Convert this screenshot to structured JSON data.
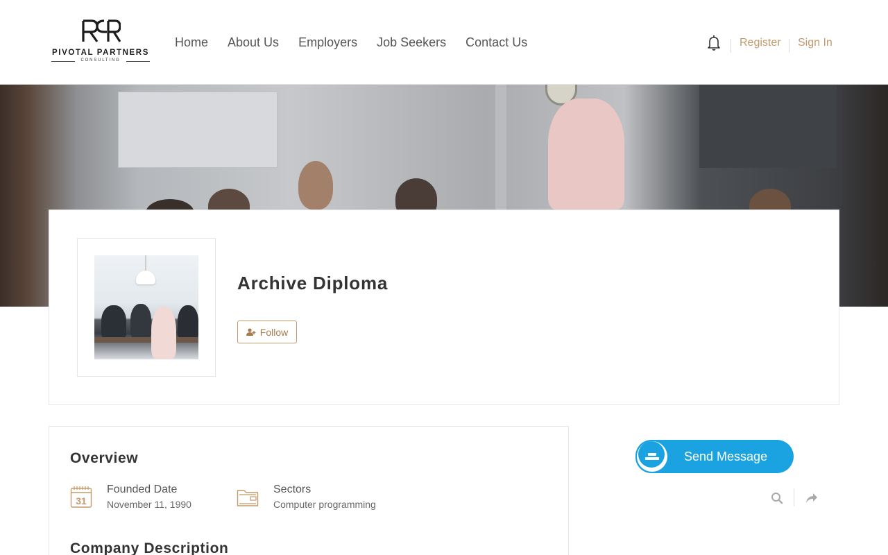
{
  "brand": {
    "name": "PIVOTAL PARTNERS",
    "tagline": "CONSULTING"
  },
  "nav": {
    "items": [
      {
        "label": "Home"
      },
      {
        "label": "About Us"
      },
      {
        "label": "Employers"
      },
      {
        "label": "Job Seekers"
      },
      {
        "label": "Contact Us"
      }
    ]
  },
  "auth": {
    "register_label": "Register",
    "signin_label": "Sign In"
  },
  "profile": {
    "company_name": "Archive Diploma",
    "follow_label": "Follow"
  },
  "overview": {
    "title": "Overview",
    "founded_label": "Founded Date",
    "founded_value": "November 11, 1990",
    "sectors_label": "Sectors",
    "sectors_value": "Computer programming",
    "description_title": "Company Description"
  },
  "sidebar": {
    "send_message_label": "Send Message"
  },
  "colors": {
    "accent": "#c49a6c",
    "send_button": "#1aa3e0"
  },
  "icons": [
    "bell-icon",
    "add-user-icon",
    "calendar-icon",
    "folder-icon",
    "message-icon",
    "search-icon",
    "share-icon"
  ]
}
